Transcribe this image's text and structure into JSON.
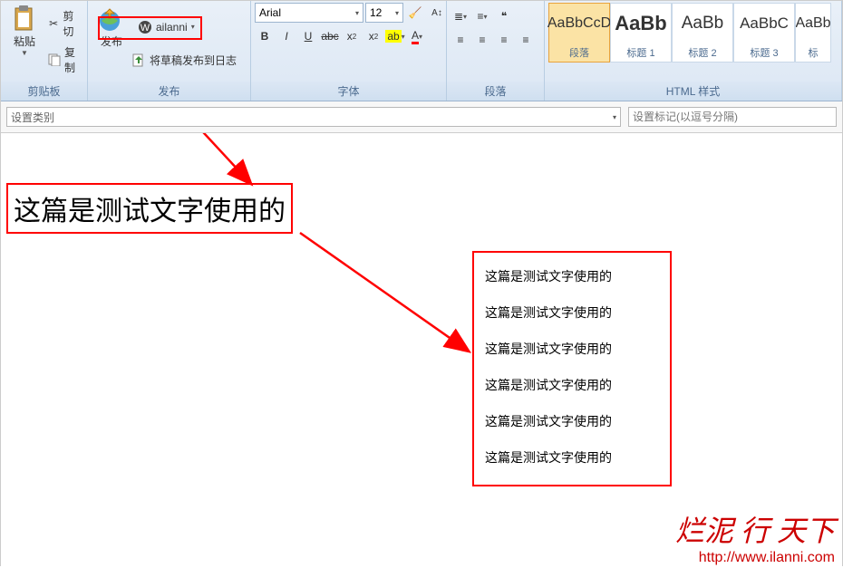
{
  "clipboard": {
    "paste": "粘贴",
    "cut": "剪切",
    "copy": "复制",
    "group": "剪贴板"
  },
  "publish": {
    "publish": "发布",
    "account": "ailanni",
    "draft": "将草稿发布到日志",
    "group": "发布"
  },
  "font": {
    "name": "Arial",
    "size": "12",
    "group": "字体"
  },
  "para": {
    "group": "段落"
  },
  "styles": {
    "group": "HTML 样式",
    "items": [
      {
        "prev": "AaBbCcD",
        "lbl": "段落"
      },
      {
        "prev": "AaBb",
        "lbl": "标题 1"
      },
      {
        "prev": "AaBb",
        "lbl": "标题 2"
      },
      {
        "prev": "AaBbC",
        "lbl": "标题 3"
      },
      {
        "prev": "AaBb",
        "lbl": "标"
      }
    ]
  },
  "catbar": {
    "cat": "设置类别",
    "tag": "设置标记(以逗号分隔)"
  },
  "doc": {
    "big": "这篇是测试文字使用的",
    "list": [
      "这篇是测试文字使用的",
      "这篇是测试文字使用的",
      "这篇是测试文字使用的",
      "这篇是测试文字使用的",
      "这篇是测试文字使用的",
      "这篇是测试文字使用的"
    ]
  },
  "wm": {
    "cn": "烂泥 行 天下",
    "url": "http://www.ilanni.com"
  }
}
